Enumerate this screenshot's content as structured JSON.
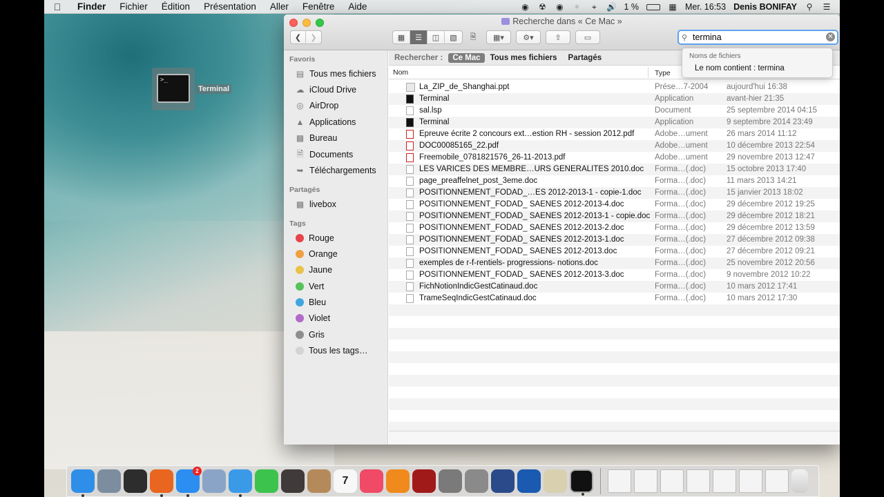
{
  "menubar": {
    "app": "Finder",
    "items": [
      "Fichier",
      "Édition",
      "Présentation",
      "Aller",
      "Fenêtre",
      "Aide"
    ],
    "battery": "1 %",
    "clock": "Mer. 16:53",
    "user": "Denis BONIFAY"
  },
  "desktop": {
    "terminal_label": "Terminal",
    "terminal_prompt": ">_"
  },
  "window": {
    "title": "Recherche dans « Ce Mac »",
    "search_value": "termina",
    "suggestion_header": "Noms de fichiers",
    "suggestion_item": "Le nom contient : termina"
  },
  "sidebar": {
    "favorites_header": "Favoris",
    "favorites": [
      "Tous mes fichiers",
      "iCloud Drive",
      "AirDrop",
      "Applications",
      "Bureau",
      "Documents",
      "Téléchargements"
    ],
    "shared_header": "Partagés",
    "shared": [
      "livebox"
    ],
    "tags_header": "Tags",
    "tags": [
      {
        "label": "Rouge",
        "color": "#e5454a"
      },
      {
        "label": "Orange",
        "color": "#f0a040"
      },
      {
        "label": "Jaune",
        "color": "#e9c24a"
      },
      {
        "label": "Vert",
        "color": "#55c25a"
      },
      {
        "label": "Bleu",
        "color": "#3fa6e0"
      },
      {
        "label": "Violet",
        "color": "#b26bc7"
      },
      {
        "label": "Gris",
        "color": "#8e8e8e"
      },
      {
        "label": "Tous les tags…",
        "color": "#d4d4d4"
      }
    ]
  },
  "scope": {
    "label": "Rechercher :",
    "options": [
      "Ce Mac",
      "Tous mes fichiers",
      "Partagés"
    ]
  },
  "columns": {
    "name": "Nom",
    "type": "Type"
  },
  "files": [
    {
      "name": "La_ZIP_de_Shanghai.ppt",
      "type": "Prése…7-2004",
      "date": "aujourd'hui 16:38",
      "icon": "ppt"
    },
    {
      "name": "Terminal",
      "type": "Application",
      "date": "avant-hier 21:35",
      "icon": "term"
    },
    {
      "name": "sal.lsp",
      "type": "Document",
      "date": "25 septembre 2014 04:15",
      "icon": "doc"
    },
    {
      "name": "Terminal",
      "type": "Application",
      "date": "9 septembre 2014 23:49",
      "icon": "term"
    },
    {
      "name": "Epreuve écrite 2 concours ext…estion RH - session 2012.pdf",
      "type": "Adobe…ument",
      "date": "26 mars 2014 11:12",
      "icon": "pdf"
    },
    {
      "name": "DOC00085165_22.pdf",
      "type": "Adobe…ument",
      "date": "10 décembre 2013 22:54",
      "icon": "pdf"
    },
    {
      "name": "Freemobile_0781821576_26-11-2013.pdf",
      "type": "Adobe…ument",
      "date": "29 novembre 2013 12:47",
      "icon": "pdf"
    },
    {
      "name": "LES VARICES DES MEMBRE…URS GENERALITES 2010.doc",
      "type": "Forma…(.doc)",
      "date": "15 octobre 2013 17:40",
      "icon": "doc"
    },
    {
      "name": "page_preaffelnet_post_3eme.doc",
      "type": "Forma…(.doc)",
      "date": "11 mars 2013 14:21",
      "icon": "doc"
    },
    {
      "name": "POSITIONNEMENT_FODAD_…ES 2012-2013-1 - copie-1.doc",
      "type": "Forma…(.doc)",
      "date": "15 janvier 2013 18:02",
      "icon": "doc"
    },
    {
      "name": "POSITIONNEMENT_FODAD_ SAENES 2012-2013-4.doc",
      "type": "Forma…(.doc)",
      "date": "29 décembre 2012 19:25",
      "icon": "doc"
    },
    {
      "name": "POSITIONNEMENT_FODAD_ SAENES 2012-2013-1 - copie.doc",
      "type": "Forma…(.doc)",
      "date": "29 décembre 2012 18:21",
      "icon": "doc"
    },
    {
      "name": "POSITIONNEMENT_FODAD_ SAENES 2012-2013-2.doc",
      "type": "Forma…(.doc)",
      "date": "29 décembre 2012 13:59",
      "icon": "doc"
    },
    {
      "name": "POSITIONNEMENT_FODAD_ SAENES 2012-2013-1.doc",
      "type": "Forma…(.doc)",
      "date": "27 décembre 2012 09:38",
      "icon": "doc"
    },
    {
      "name": "POSITIONNEMENT_FODAD_ SAENES 2012-2013.doc",
      "type": "Forma…(.doc)",
      "date": "27 décembre 2012 09:21",
      "icon": "doc"
    },
    {
      "name": "exemples de r-f-rentiels- progressions- notions.doc",
      "type": "Forma…(.doc)",
      "date": "25 novembre 2012 20:56",
      "icon": "doc"
    },
    {
      "name": "POSITIONNEMENT_FODAD_ SAENES 2012-2013-3.doc",
      "type": "Forma…(.doc)",
      "date": "9 novembre 2012 10:22",
      "icon": "doc"
    },
    {
      "name": "FichNotionIndicGestCatinaud.doc",
      "type": "Forma…(.doc)",
      "date": "10 mars 2012 17:41",
      "icon": "doc"
    },
    {
      "name": "TrameSeqIndicGestCatinaud.doc",
      "type": "Forma…(.doc)",
      "date": "10 mars 2012 17:30",
      "icon": "doc"
    }
  ],
  "dock": {
    "items": [
      {
        "name": "finder",
        "color": "#2f8fe8",
        "running": true
      },
      {
        "name": "launchpad",
        "color": "#7c8da0",
        "running": false
      },
      {
        "name": "mission-control",
        "color": "#2d2d2d",
        "running": false
      },
      {
        "name": "firefox",
        "color": "#e8661f",
        "running": true
      },
      {
        "name": "app-store",
        "color": "#2b8ef0",
        "running": true,
        "badge": "2"
      },
      {
        "name": "preview",
        "color": "#8aa4c8",
        "running": false
      },
      {
        "name": "safari",
        "color": "#3a9ae8",
        "running": true
      },
      {
        "name": "facetime",
        "color": "#3cc34e",
        "running": false
      },
      {
        "name": "imovie",
        "color": "#403a3a",
        "running": false
      },
      {
        "name": "contacts",
        "color": "#b58a5a",
        "running": false
      },
      {
        "name": "calendar",
        "color": "#f7f7f7",
        "running": false
      },
      {
        "name": "itunes",
        "color": "#f04a66",
        "running": false
      },
      {
        "name": "ibooks",
        "color": "#f08a1c",
        "running": false
      },
      {
        "name": "photo-booth",
        "color": "#a01a1a",
        "running": false
      },
      {
        "name": "system-preferences",
        "color": "#7a7a7a",
        "running": false
      },
      {
        "name": "printer",
        "color": "#8a8a8a",
        "running": false
      },
      {
        "name": "quicktime",
        "color": "#2a4a8a",
        "running": false
      },
      {
        "name": "xquartz",
        "color": "#1a5ab0",
        "running": false
      },
      {
        "name": "utility",
        "color": "#d9d0b0",
        "running": false
      },
      {
        "name": "terminal",
        "color": "#111111",
        "running": true
      }
    ],
    "docs": [
      "doc-1",
      "doc-2",
      "doc-3",
      "doc-4",
      "doc-5",
      "doc-6",
      "doc-7"
    ],
    "calendar_day": "7"
  }
}
